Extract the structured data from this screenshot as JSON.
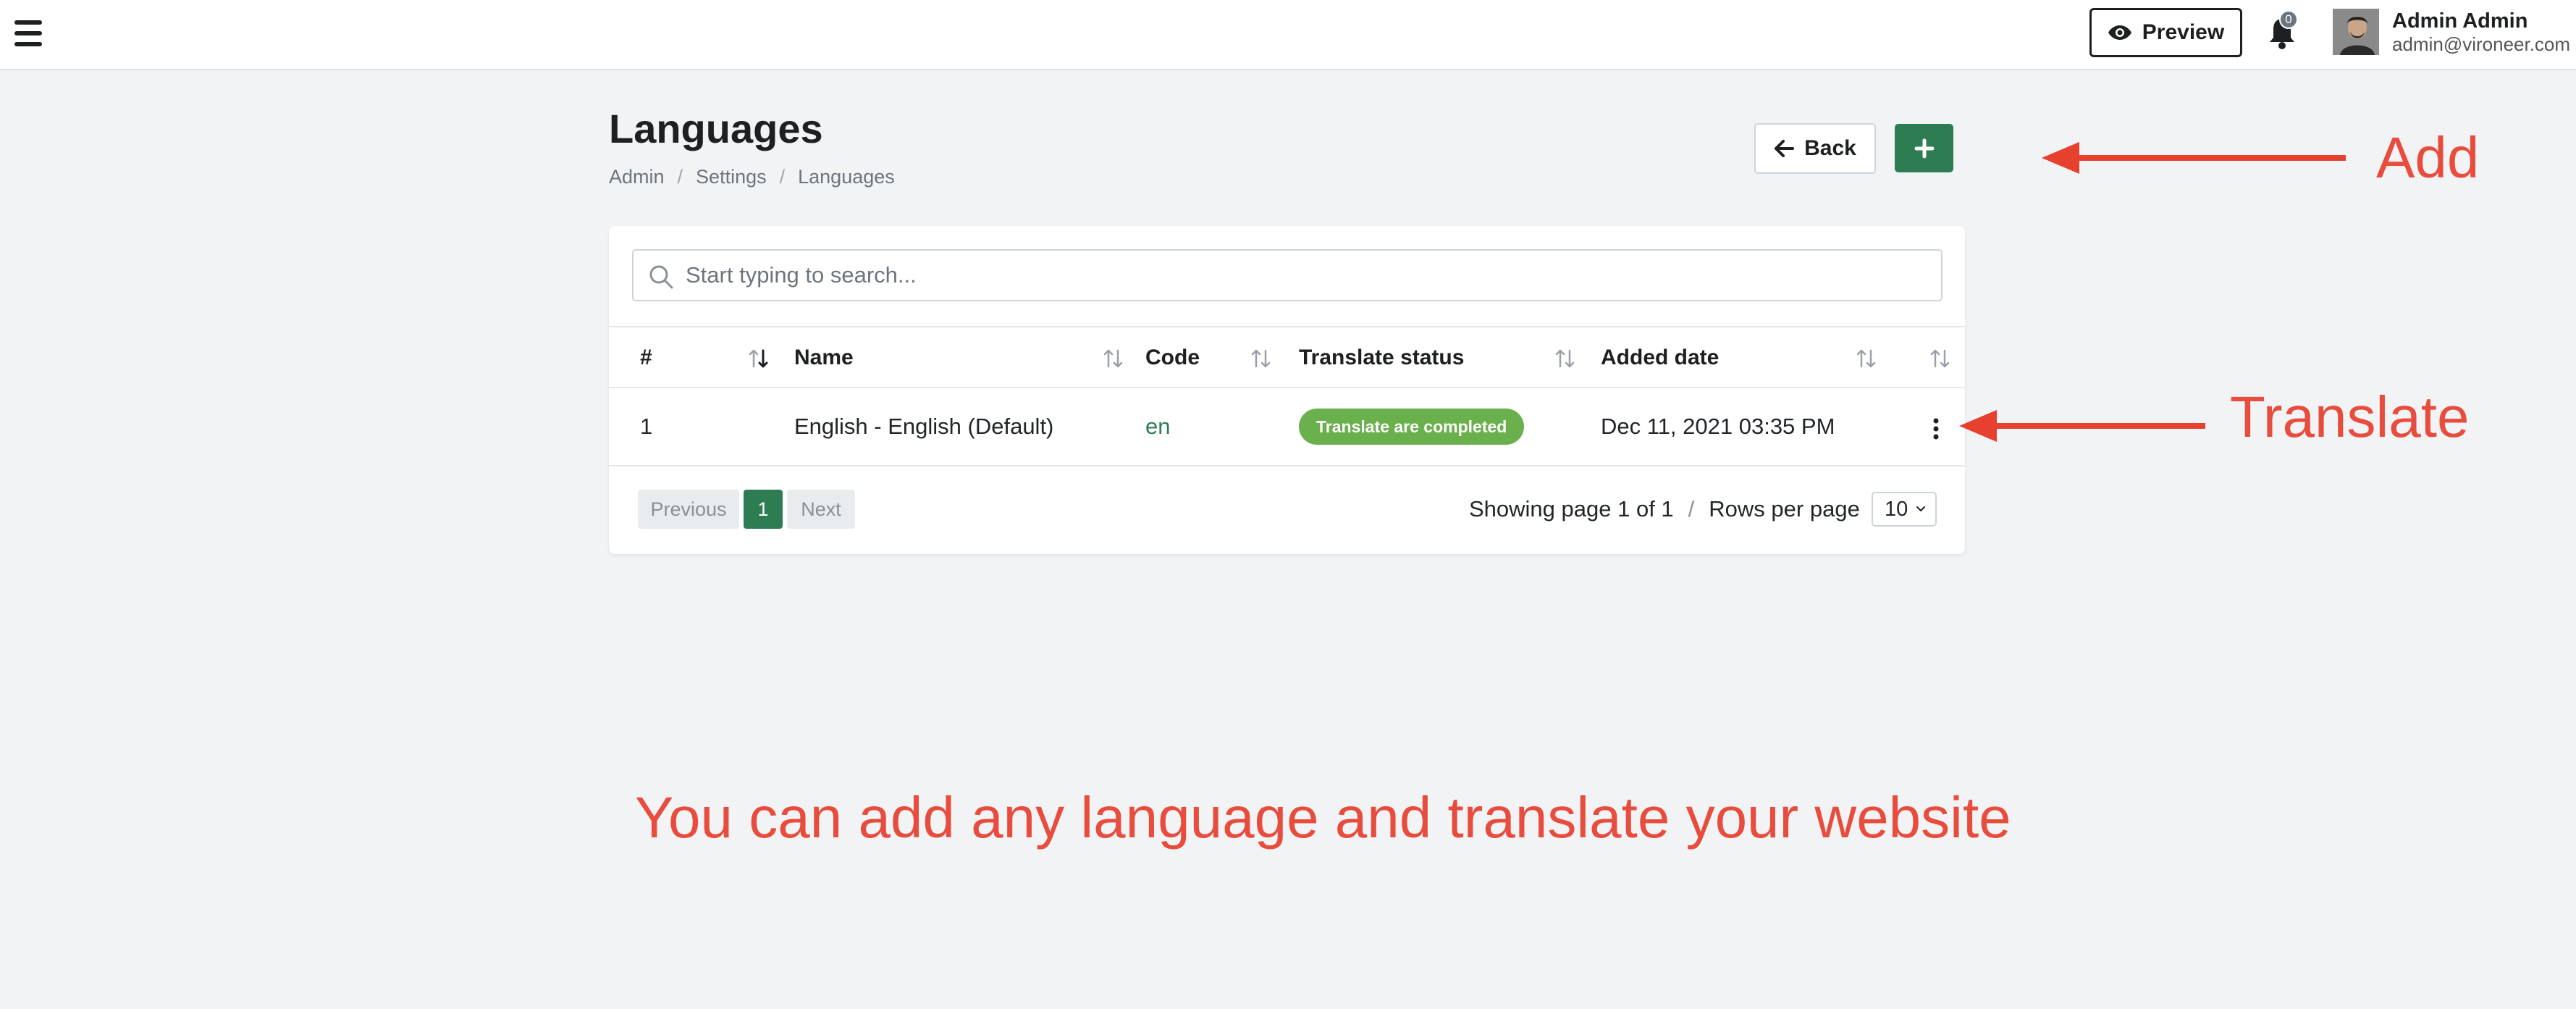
{
  "topbar": {
    "preview_label": "Preview",
    "notification_count": "0",
    "user_name": "Admin Admin",
    "user_email": "admin@vironeer.com"
  },
  "page": {
    "title": "Languages",
    "breadcrumb": [
      "Admin",
      "Settings",
      "Languages"
    ],
    "back_label": "Back",
    "add_icon": "plus-icon"
  },
  "search": {
    "placeholder": "Start typing to search..."
  },
  "table": {
    "columns": [
      "#",
      "Name",
      "Code",
      "Translate status",
      "Added date"
    ],
    "rows": [
      {
        "id": "1",
        "name": "English - English (Default)",
        "code": "en",
        "status": "Translate are completed",
        "added": "Dec 11, 2021 03:35 PM"
      }
    ]
  },
  "pagination": {
    "previous": "Previous",
    "current": "1",
    "next": "Next",
    "showing": "Showing page 1 of 1",
    "separator": "/",
    "rows_per_page_label": "Rows per page",
    "rows_per_page_value": "10"
  },
  "annotations": {
    "add": "Add",
    "translate": "Translate",
    "caption": "You can add any language and translate your website"
  },
  "colors": {
    "accent_green": "#2e7d52",
    "badge_green": "#6ab04c",
    "annotation_red": "#e84c3d"
  }
}
